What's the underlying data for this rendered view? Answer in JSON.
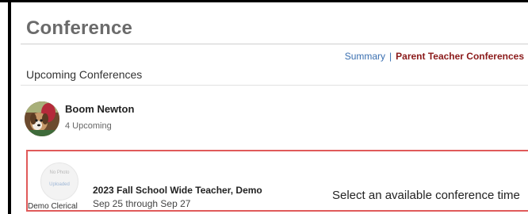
{
  "page": {
    "title": "Conference"
  },
  "tabs": {
    "summary": "Summary",
    "separator": "|",
    "parent_teacher": "Parent Teacher Conferences"
  },
  "section": {
    "heading": "Upcoming Conferences"
  },
  "student": {
    "name": "Boom Newton",
    "subtitle": "4 Upcoming"
  },
  "conference": {
    "title": "2023 Fall School Wide  Teacher, Demo",
    "dates": "Sep 25 through Sep 27",
    "action": "Select an available conference time",
    "teacher_caption": "Demo Clerical",
    "no_photo_label": "No Photo",
    "no_photo_sub": "Uploaded"
  },
  "colors": {
    "title_gray": "#6b6b6b",
    "link_blue": "#3a6fb0",
    "active_tab_red": "#8b1a1a",
    "highlight_border": "#e05a5a"
  }
}
